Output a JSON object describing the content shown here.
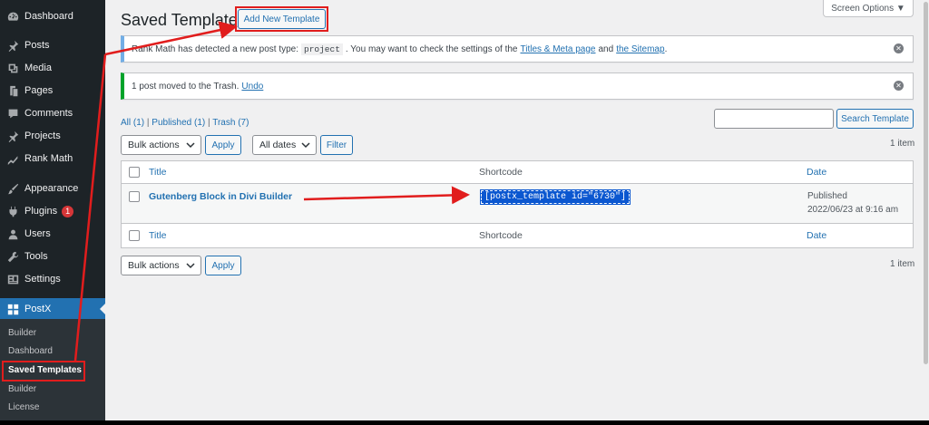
{
  "sidebar": {
    "items": [
      {
        "label": "Dashboard",
        "icon": "dashboard-icon"
      },
      {
        "label": "Posts",
        "icon": "pin-icon"
      },
      {
        "label": "Media",
        "icon": "media-icon"
      },
      {
        "label": "Pages",
        "icon": "pages-icon"
      },
      {
        "label": "Comments",
        "icon": "comment-icon"
      },
      {
        "label": "Projects",
        "icon": "pin-icon"
      },
      {
        "label": "Rank Math",
        "icon": "chart-icon"
      },
      {
        "label": "Appearance",
        "icon": "brush-icon"
      },
      {
        "label": "Plugins",
        "icon": "plugin-icon",
        "badge": "1"
      },
      {
        "label": "Users",
        "icon": "user-icon"
      },
      {
        "label": "Tools",
        "icon": "wrench-icon"
      },
      {
        "label": "Settings",
        "icon": "settings-icon"
      },
      {
        "label": "PostX",
        "icon": "postx-icon"
      }
    ],
    "submenu": [
      "Builder",
      "Dashboard",
      "Saved Templates",
      "Builder",
      "License"
    ]
  },
  "header": {
    "title": "Saved Templates",
    "add_new_label": "Add New Template",
    "screen_options_label": "Screen Options ▼"
  },
  "notices": {
    "rankmath": {
      "text_before": "Rank Math has detected a new post type:",
      "code": "project",
      "text_middle": ". You may want to check the settings of the",
      "link1": "Titles & Meta page",
      "and": "and",
      "link2": "the Sitemap",
      "end": "."
    },
    "trash": {
      "text": "1 post moved to the Trash.",
      "undo": "Undo"
    }
  },
  "filters": {
    "all": "All (1)",
    "published": "Published (1)",
    "trash": "Trash (7)",
    "sep": "|"
  },
  "search": {
    "button": "Search Template",
    "value": ""
  },
  "tablenav_top": {
    "bulk_actions": "Bulk actions",
    "apply": "Apply",
    "all_dates": "All dates",
    "filter": "Filter",
    "count": "1 item"
  },
  "table": {
    "columns": {
      "title": "Title",
      "shortcode": "Shortcode",
      "date": "Date"
    },
    "rows": [
      {
        "title": "Gutenberg Block in Divi Builder",
        "shortcode": "[postx_template id=\"6730\"]",
        "status": "Published",
        "date": "2022/06/23 at 9:16 am"
      }
    ]
  },
  "tablenav_bottom": {
    "bulk_actions": "Bulk actions",
    "apply": "Apply",
    "count": "1 item"
  },
  "colors": {
    "sidebar_bg": "#1d2327",
    "accent": "#2271b1",
    "annotation_red": "#e11d1d"
  }
}
